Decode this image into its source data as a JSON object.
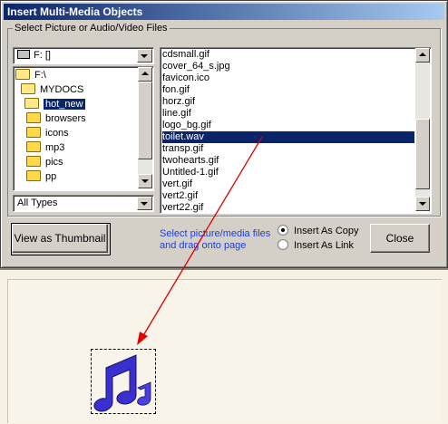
{
  "dialog": {
    "title": "Insert Multi-Media Objects",
    "group_label": "Select Picture or Audio/Video Files",
    "drive": "F: []",
    "folders": [
      {
        "label": "F:\\",
        "open": true,
        "selected": false
      },
      {
        "label": "MYDOCS",
        "open": true,
        "selected": false
      },
      {
        "label": "hot_new",
        "open": true,
        "selected": true
      },
      {
        "label": "browsers",
        "open": false,
        "selected": false
      },
      {
        "label": "icons",
        "open": false,
        "selected": false
      },
      {
        "label": "mp3",
        "open": false,
        "selected": false
      },
      {
        "label": "pics",
        "open": false,
        "selected": false
      },
      {
        "label": "pp",
        "open": false,
        "selected": false
      }
    ],
    "file_type": "All Types",
    "files": [
      "cdsmall.gif",
      "cover_64_s.jpg",
      "favicon.ico",
      "fon.gif",
      "horz.gif",
      "line.gif",
      "logo_bg.gif",
      "toilet.wav",
      "transp.gif",
      "twohearts.gif",
      "Untitled-1.gif",
      "vert.gif",
      "vert2.gif",
      "vert22.gif"
    ],
    "selected_file": "toilet.wav",
    "view_thumbnail_label": "View as Thumbnail",
    "hint_line1": "Select picture/media files",
    "hint_line2": "and drag onto page",
    "radio_copy_label": "Insert As Copy",
    "radio_link_label": "Insert As Link",
    "radio_selected": "copy",
    "close_label": "Close"
  },
  "colors": {
    "title_bar": "#0a246a",
    "selection": "#0a246a",
    "hint_text": "#1a3fe0",
    "arrow": "#e00000",
    "music_note": "#3a2fd0"
  },
  "icons": {
    "drag_target": "music-note-icon"
  }
}
